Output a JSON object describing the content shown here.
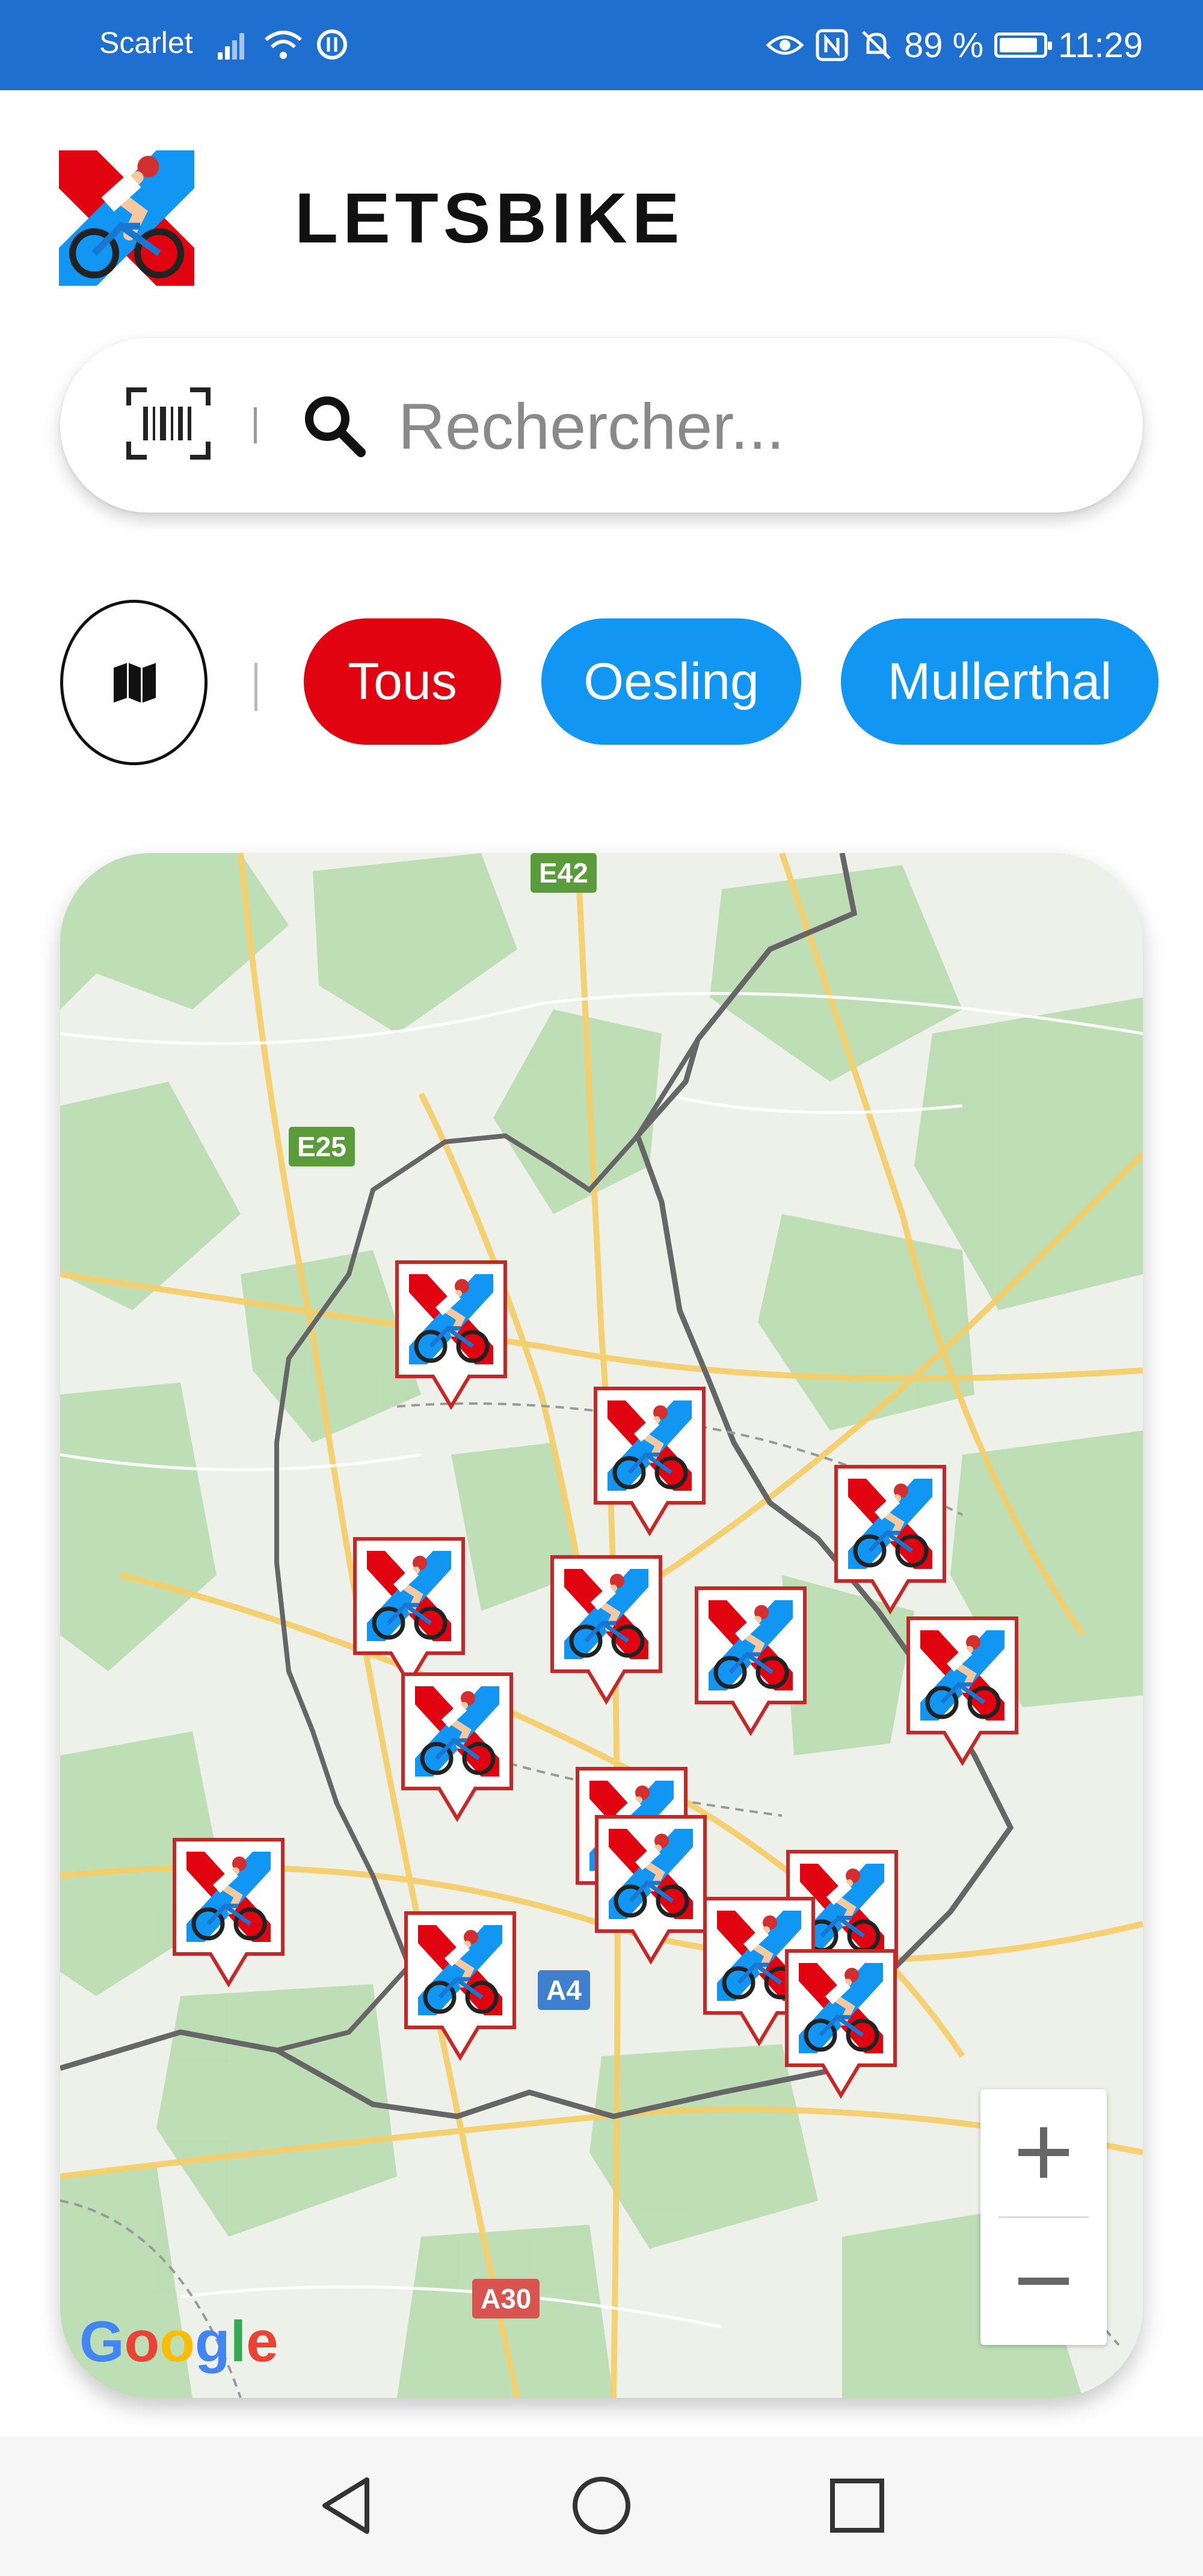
{
  "status_bar": {
    "carrier": "Scarlet",
    "battery": "89 %",
    "battery_level": 0.89,
    "time": "11:29",
    "icons": [
      "signal-icon",
      "wifi-icon",
      "data-saver-icon",
      "eye-comfort-icon",
      "nfc-icon",
      "mute-icon",
      "battery-icon"
    ]
  },
  "header": {
    "brand": "LETSBIKE",
    "logo_icon": "cyclist-logo-icon"
  },
  "search": {
    "placeholder": "Rechercher...",
    "scan_icon": "barcode-scan-icon",
    "search_icon": "search-icon"
  },
  "filters": {
    "map_toggle_icon": "map-icon",
    "chips": [
      {
        "label": "Tous",
        "active": true,
        "color": "#e1030f"
      },
      {
        "label": "Oesling",
        "active": false,
        "color": "#1196f3"
      },
      {
        "label": "Mullerthal",
        "active": false,
        "color": "#1196f3"
      }
    ]
  },
  "map": {
    "road_labels": [
      "E42",
      "E25",
      "A4",
      "A30"
    ],
    "attribution": "Google",
    "zoom_in_icon": "plus-icon",
    "zoom_out_icon": "minus-icon",
    "marker_count": 17
  },
  "nav_bar": {
    "icons": [
      "back-triangle-icon",
      "home-circle-icon",
      "recents-square-icon"
    ]
  },
  "colors": {
    "status_bar": "#1f6fd1",
    "accent_red": "#e1030f",
    "accent_blue": "#1196f3"
  }
}
